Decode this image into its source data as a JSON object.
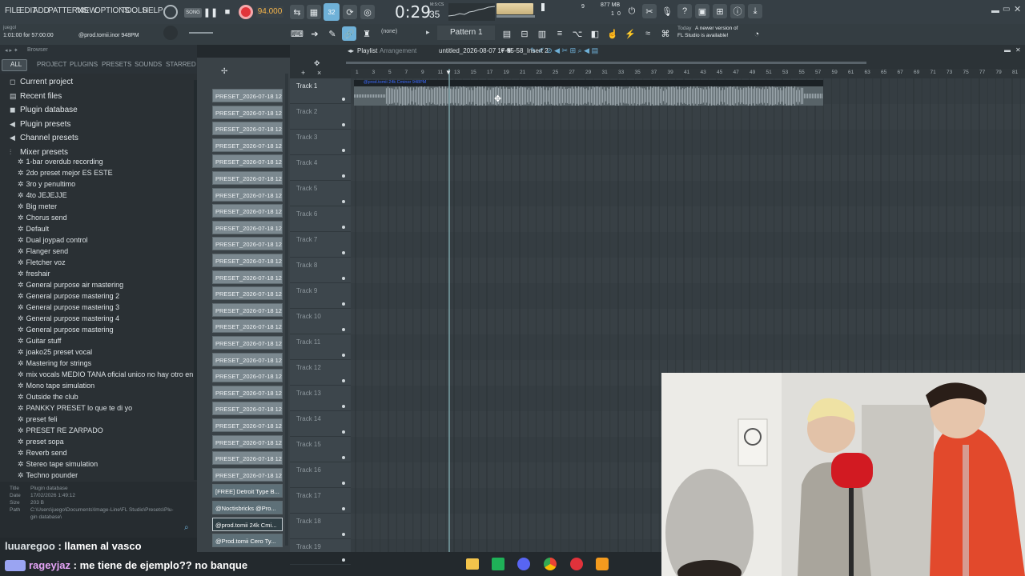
{
  "menu": [
    "FILE",
    "EDIT",
    "ADD",
    "PATTERNS",
    "VIEW",
    "OPTIONS",
    "TOOLS",
    "HELP"
  ],
  "transport": {
    "song_label": "SONG",
    "tempo": "94.000",
    "time": "0:29",
    "time_sub": "35",
    "time_unit": "M:S:CS",
    "memory": "877 MB",
    "cpu": "1",
    "cpu2": "9",
    "poly": "0"
  },
  "hint": {
    "position": "1:01:00 for 57:00:00",
    "clip": "@prod.tomii.inor 948PM",
    "user": "juegol"
  },
  "toolbar2": {
    "none_label": "(none)",
    "pattern_label": "Pattern 1",
    "news_line1": "A newer version of",
    "news_line2": "FL Studio is available!",
    "news_today": "Today"
  },
  "browser": {
    "title": "Browser",
    "tabs": [
      "ALL",
      "PROJECT",
      "PLUGINS",
      "PRESETS",
      "SOUNDS",
      "STARRED"
    ],
    "folders": [
      {
        "label": "Current project",
        "icon": "project-icon"
      },
      {
        "label": "Recent files",
        "icon": "recent-icon"
      },
      {
        "label": "Plugin database",
        "icon": "database-icon"
      },
      {
        "label": "Plugin presets",
        "icon": "plugin-icon"
      },
      {
        "label": "Channel presets",
        "icon": "channel-icon"
      },
      {
        "label": "Mixer presets",
        "icon": "mixer-icon"
      }
    ],
    "presets": [
      "1-bar overdub recording",
      "2do preset mejor ES ESTE",
      "3ro y penultimo",
      "4to JEJEJJE",
      "Big meter",
      "Chorus send",
      "Default",
      "Dual joypad control",
      "Flanger send",
      "Fletcher voz",
      "freshair",
      "General purpose air mastering",
      "General purpose mastering 2",
      "General purpose mastering 3",
      "General purpose mastering 4",
      "General purpose mastering",
      "Guitar stuff",
      "joako25 preset vocal",
      "Mastering for strings",
      "mix vocals MEDIO TANA oficial unico no hay otro en el mundo",
      "Mono tape simulation",
      "Outside the club",
      "PANKKY PRESET lo que te di yo",
      "preset feli",
      "PRESET RE ZARPADO",
      "preset sopa",
      "Reverb send",
      "Stereo tape simulation",
      "Techno pounder"
    ]
  },
  "info": {
    "title_k": "Title",
    "title_v": "Plugin database",
    "date_k": "Date",
    "date_v": "17/02/2026 1:49:12",
    "size_k": "Size",
    "size_v": "203 B",
    "path_k": "Path",
    "path_v": "C:\\Users\\juego\\Documents\\Image-Line\\FL Studio\\Presets\\Plu-",
    "path_v2": "gin database\\"
  },
  "chat": [
    {
      "user": "luuaregoo",
      "msg": " : llamen al vasco"
    },
    {
      "user": "rageyjaz",
      "msg": " : me tiene de ejemplo?? no banque"
    }
  ],
  "playlist": {
    "title": "Playlist",
    "subtitle": "Arrangement",
    "project": "untitled_2026-08-07 17-55-58_Insert 2",
    "clip_label": "@prod.tomii 24k Cminor 948PM"
  },
  "patterns": [
    "PRESET_2026-07-18 12-...",
    "PRESET_2026-07-18 12-...",
    "PRESET_2026-07-18 12-...",
    "PRESET_2026-07-18 12-...",
    "PRESET_2026-07-18 12-...",
    "PRESET_2026-07-18 12-...",
    "PRESET_2026-07-18 12-...",
    "PRESET_2026-07-18 12-...",
    "PRESET_2026-07-18 12-...",
    "PRESET_2026-07-18 12-...",
    "PRESET_2026-07-18 12-...",
    "PRESET_2026-07-18 12-...",
    "PRESET_2026-07-18 12-...",
    "PRESET_2026-07-18 12-...",
    "PRESET_2026-07-18 12-...",
    "PRESET_2026-07-18 12-...",
    "PRESET_2026-07-18 12-...",
    "PRESET_2026-07-18 12-...",
    "PRESET_2026-07-18 12-...",
    "PRESET_2026-07-18 12-...",
    "PRESET_2026-07-18 12-...",
    "PRESET_2026-07-18 12-...",
    "PRESET_2026-07-18 12-...",
    "PRESET_2026-07-18 12-...",
    "[FREE] Detroit Type B...",
    "@Noctisbricks @Pro...",
    "@prod.tomii 24k Cmi...",
    "@Prod.tomii Cero Ty..."
  ],
  "tracks": [
    "Track 1",
    "Track 2",
    "Track 3",
    "Track 4",
    "Track 5",
    "Track 6",
    "Track 7",
    "Track 8",
    "Track 9",
    "Track 10",
    "Track 11",
    "Track 12",
    "Track 13",
    "Track 14",
    "Track 15",
    "Track 16",
    "Track 17",
    "Track 18",
    "Track 19"
  ],
  "ruler": [
    "1",
    "3",
    "5",
    "7",
    "9",
    "11",
    "13",
    "15",
    "17",
    "19",
    "21",
    "23",
    "25",
    "27",
    "29",
    "31",
    "33",
    "35",
    "37",
    "39",
    "41",
    "43",
    "45",
    "47",
    "49",
    "51",
    "53",
    "55",
    "57",
    "59",
    "61",
    "63",
    "65",
    "67",
    "69",
    "71",
    "73",
    "75",
    "77",
    "79",
    "81"
  ],
  "colors": {
    "record": "#e2343a",
    "accent": "#9fd84a",
    "track_bg": "#3d464c",
    "clip": "#586368"
  }
}
